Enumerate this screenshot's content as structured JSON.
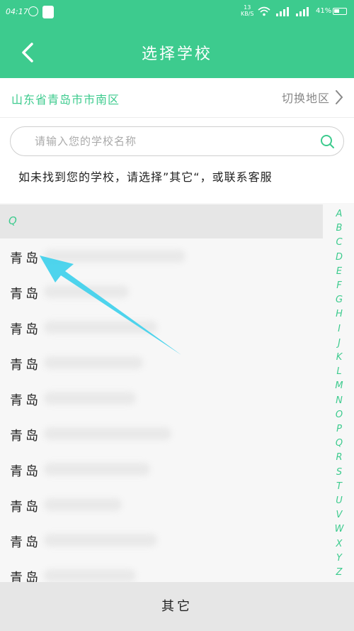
{
  "status_bar": {
    "time": "04:17",
    "speed_value": "13",
    "speed_unit": "KB/S",
    "battery": "41%"
  },
  "nav": {
    "title": "选择学校"
  },
  "region": {
    "name": "山东省青岛市市南区",
    "switch_label": "切换地区"
  },
  "search": {
    "placeholder": "请输入您的学校名称",
    "hint": "如未找到您的学校，请选择”其它“，或联系客服"
  },
  "list": {
    "section_letter": "Q",
    "items": [
      "青岛",
      "青岛",
      "青岛",
      "青岛",
      "青岛",
      "青岛",
      "青岛",
      "青岛",
      "青岛",
      "青岛"
    ]
  },
  "alpha_index": [
    "A",
    "B",
    "C",
    "D",
    "E",
    "F",
    "G",
    "H",
    "I",
    "J",
    "K",
    "L",
    "M",
    "N",
    "O",
    "P",
    "Q",
    "R",
    "S",
    "T",
    "U",
    "V",
    "W",
    "X",
    "Y",
    "Z"
  ],
  "bottom": {
    "other_label": "其它"
  },
  "colors": {
    "accent": "#3dcb8e",
    "arrow": "#3fd0ec"
  }
}
